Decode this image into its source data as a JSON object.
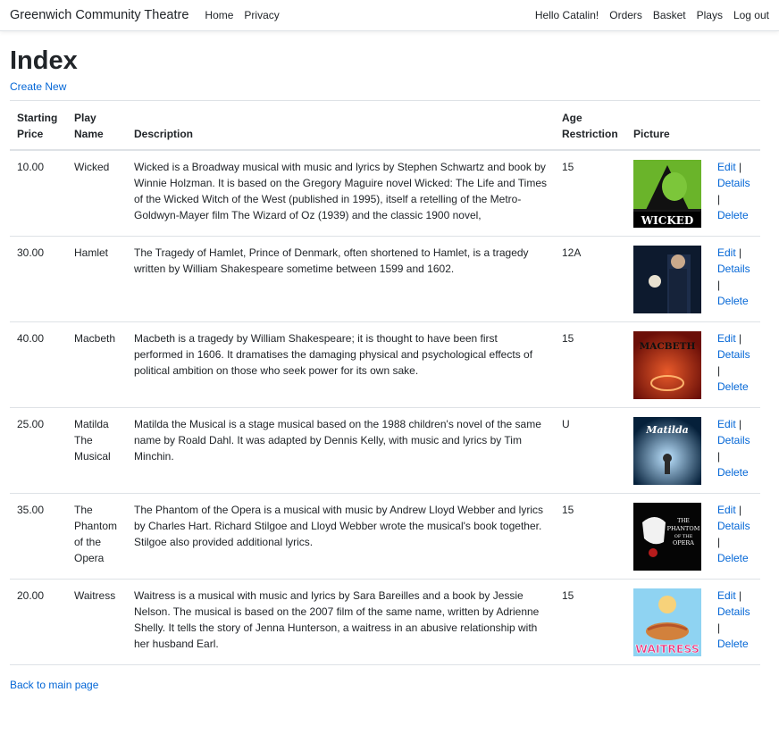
{
  "nav": {
    "brand": "Greenwich Community Theatre",
    "left": [
      "Home",
      "Privacy"
    ],
    "right": [
      "Hello Catalin!",
      "Orders",
      "Basket",
      "Plays",
      "Log out"
    ]
  },
  "page": {
    "title": "Index",
    "create_new": "Create New",
    "back_link": "Back to main page"
  },
  "table": {
    "headers": {
      "price": "Starting Price",
      "name": "Play Name",
      "description": "Description",
      "age": "Age Restriction",
      "picture": "Picture"
    },
    "actions": {
      "edit": "Edit",
      "details": "Details",
      "delete": "Delete",
      "sep": "|"
    },
    "rows": [
      {
        "price": "10.00",
        "name": "Wicked",
        "description": "Wicked is a Broadway musical with music and lyrics by Stephen Schwartz and book by Winnie Holzman. It is based on the Gregory Maguire novel Wicked: The Life and Times of the Wicked Witch of the West (published in 1995), itself a retelling of the Metro-Goldwyn-Mayer film The Wizard of Oz (1939) and the classic 1900 novel,",
        "age": "15",
        "picture_text": "WICKED"
      },
      {
        "price": "30.00",
        "name": "Hamlet",
        "description": "The Tragedy of Hamlet, Prince of Denmark, often shortened to Hamlet, is a tragedy written by William Shakespeare sometime between 1599 and 1602.",
        "age": "12A",
        "picture_text": ""
      },
      {
        "price": "40.00",
        "name": "Macbeth",
        "description": "Macbeth is a tragedy by William Shakespeare; it is thought to have been first performed in 1606. It dramatises the damaging physical and psychological effects of political ambition on those who seek power for its own sake.",
        "age": "15",
        "picture_text": "MACBETH"
      },
      {
        "price": "25.00",
        "name": "Matilda The Musical",
        "description": "Matilda the Musical is a stage musical based on the 1988 children's novel of the same name by Roald Dahl. It was adapted by Dennis Kelly, with music and lyrics by Tim Minchin.",
        "age": "U",
        "picture_text": "Matilda"
      },
      {
        "price": "35.00",
        "name": "The Phantom of the Opera",
        "description": "The Phantom of the Opera is a musical with music by Andrew Lloyd Webber and lyrics by Charles Hart. Richard Stilgoe and Lloyd Webber wrote the musical's book together. Stilgoe also provided additional lyrics.",
        "age": "15",
        "picture_text": "THE PHANTOM OF THE OPERA"
      },
      {
        "price": "20.00",
        "name": "Waitress",
        "description": "Waitress is a musical with music and lyrics by Sara Bareilles and a book by Jessie Nelson. The musical is based on the 2007 film of the same name, written by Adrienne Shelly. It tells the story of Jenna Hunterson, a waitress in an abusive relationship with her husband Earl.",
        "age": "15",
        "picture_text": "WAITRESS"
      }
    ]
  }
}
